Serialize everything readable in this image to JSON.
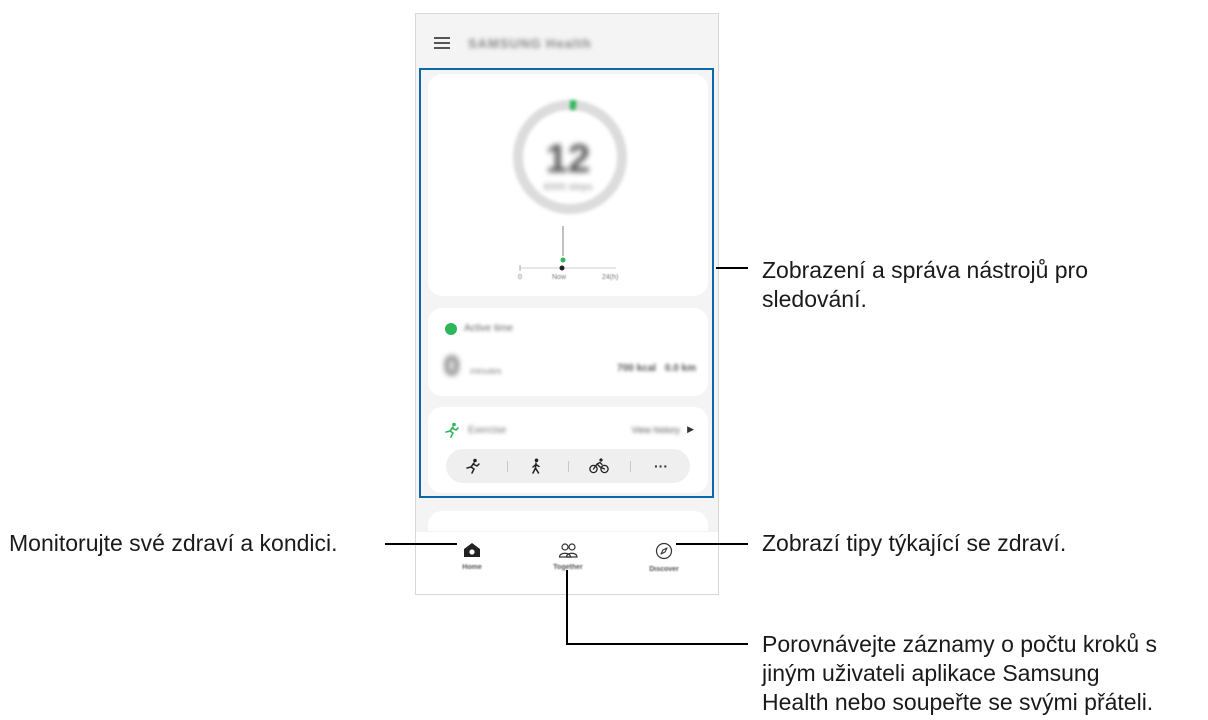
{
  "app": {
    "title": "SAMSUNG Health"
  },
  "steps_card": {
    "value": "12",
    "caption": "6000 steps",
    "axis_start": "0",
    "axis_mid": "Now",
    "axis_end": "24(h)"
  },
  "active_card": {
    "title": "Active time",
    "value": "0",
    "unit": "minutes",
    "calories": "700 kcal",
    "distance": "0.0 km"
  },
  "exercise_card": {
    "title": "Exercise",
    "link": "View history"
  },
  "nav": {
    "home": "Home",
    "together": "Together",
    "discover": "Discover"
  },
  "callouts": {
    "tracker": [
      "Zobrazení a správa nástrojů pro",
      "sledování."
    ],
    "home": "Monitorujte své zdraví a kondici.",
    "discover": "Zobrazí tipy týkající se zdraví.",
    "together": [
      "Porovnávejte záznamy o počtu kroků s",
      "jiným uživateli aplikace Samsung",
      "Health nebo soupeřte se svými přáteli."
    ]
  },
  "colors": {
    "accent_green": "#2fb55a",
    "highlight_blue": "#0b6aa6"
  },
  "icons": [
    "menu-icon",
    "clock-icon",
    "running-icon",
    "walking-icon",
    "cycling-icon",
    "more-icon",
    "home-icon",
    "together-icon",
    "discover-icon"
  ]
}
